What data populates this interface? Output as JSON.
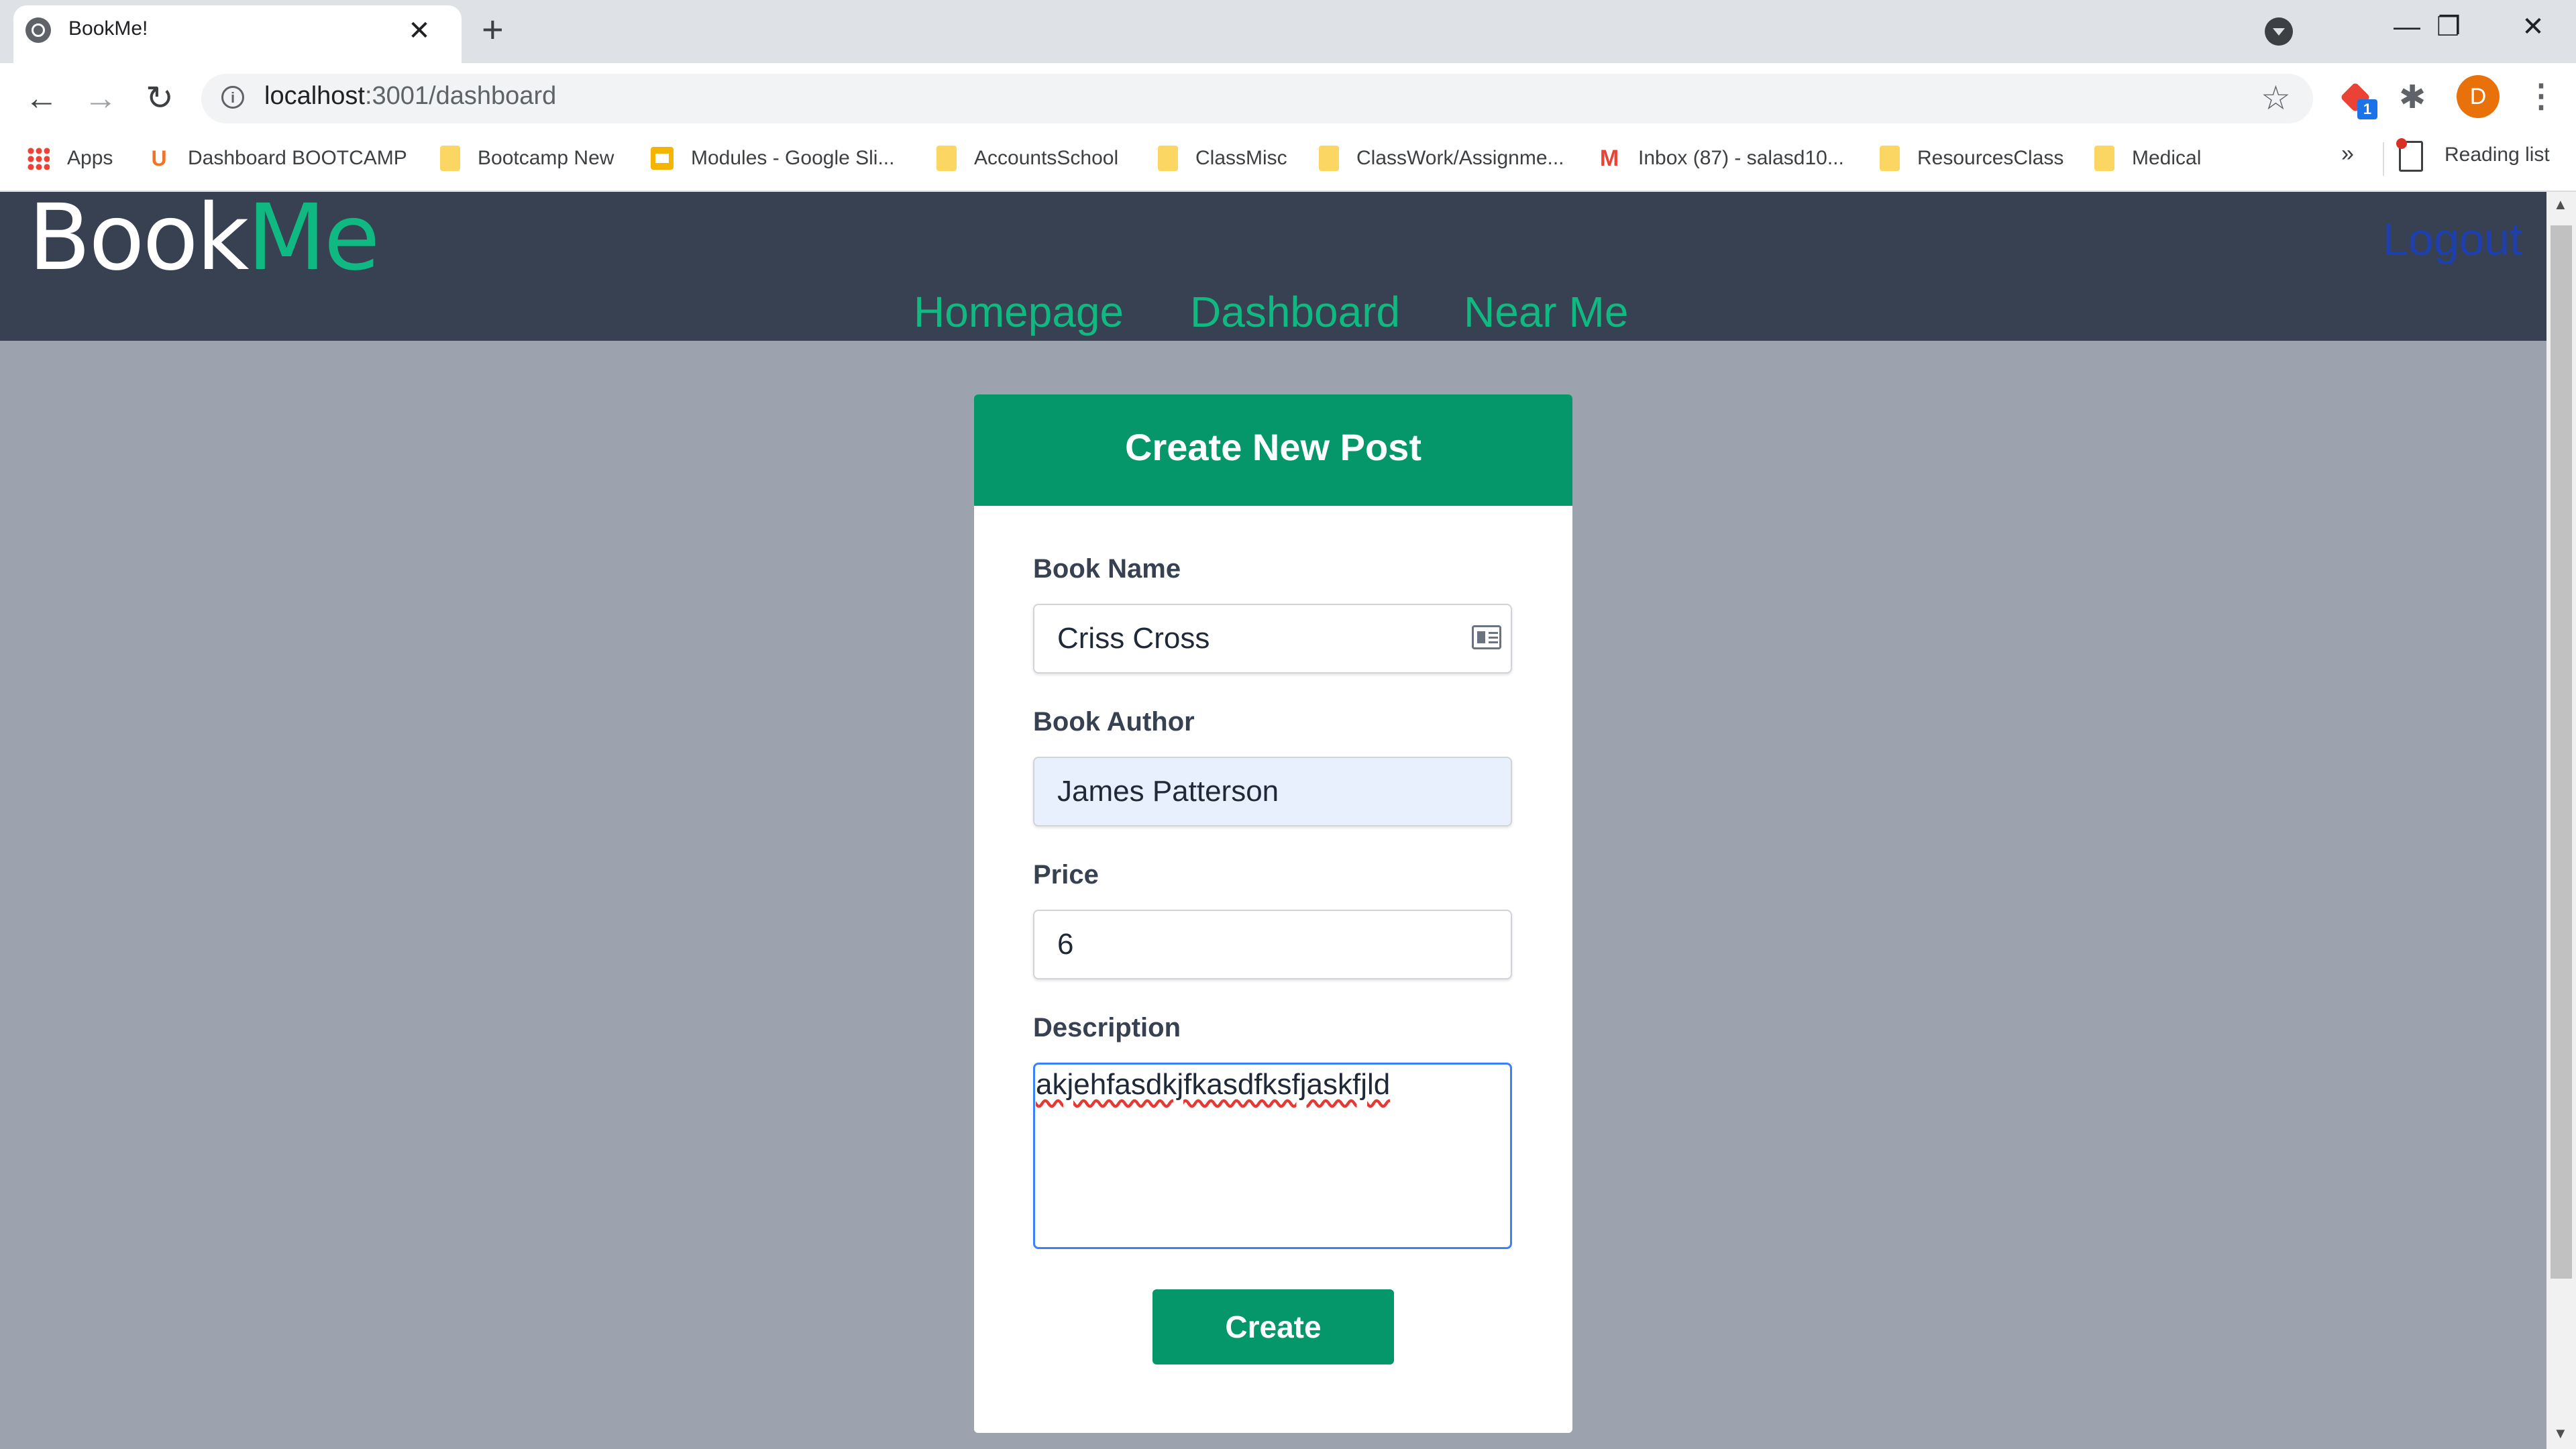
{
  "browser": {
    "tab_title": "BookMe!",
    "tab_close": "✕",
    "new_tab": "+",
    "url_host": "localhost",
    "url_path": ":3001/dashboard",
    "window_controls": {
      "minimize": "—",
      "restore": "❐",
      "close": "✕"
    },
    "avatar_letter": "D",
    "extension_badge": "1",
    "bookmarks": [
      {
        "label": "Apps",
        "icon": "apps-grid-icon"
      },
      {
        "label": "Dashboard BOOTCAMP",
        "icon": "u-logo-icon"
      },
      {
        "label": "Bootcamp New",
        "icon": "folder-icon"
      },
      {
        "label": "Modules - Google Sli...",
        "icon": "slides-icon"
      },
      {
        "label": "AccountsSchool",
        "icon": "folder-icon"
      },
      {
        "label": "ClassMisc",
        "icon": "folder-icon"
      },
      {
        "label": "ClassWork/Assignme...",
        "icon": "folder-icon"
      },
      {
        "label": "Inbox (87) - salasd10...",
        "icon": "gmail-icon"
      },
      {
        "label": "ResourcesClass",
        "icon": "folder-icon"
      },
      {
        "label": "Medical",
        "icon": "folder-icon"
      }
    ],
    "bookmarks_more": "»",
    "reading_list": "Reading list"
  },
  "header": {
    "logo_part1": "Book",
    "logo_part2": "Me",
    "logout": "Logout",
    "nav": [
      "Homepage",
      "Dashboard",
      "Near Me"
    ]
  },
  "form": {
    "title": "Create New Post",
    "book_name_label": "Book Name",
    "book_name_value": "Criss Cross",
    "book_author_label": "Book Author",
    "book_author_value": "James Patterson",
    "price_label": "Price",
    "price_value": "6",
    "description_label": "Description",
    "description_value": "akjehfasdkjfkasdfksfjaskfjld",
    "submit_label": "Create"
  },
  "colors": {
    "header_bg": "#374151",
    "accent_green": "#10b981",
    "button_green": "#059669",
    "page_bg": "#9ca3af",
    "logout_blue": "#1e40af"
  }
}
